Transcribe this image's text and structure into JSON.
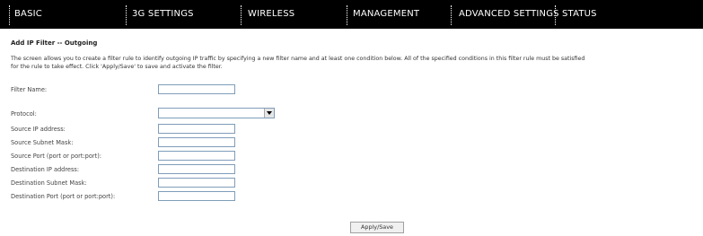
{
  "nav": {
    "items": [
      "BASIC",
      "3G SETTINGS",
      "WIRELESS",
      "MANAGEMENT",
      "ADVANCED SETTINGS",
      "STATUS"
    ]
  },
  "page": {
    "title": "Add IP Filter -- Outgoing",
    "description_line1": "The screen allows you to create a filter rule to identify outgoing IP traffic by specifying a new filter name and at least one condition below. All of the specified conditions in this filter rule must be satisfied",
    "description_line2": "for the rule to take effect. Click 'Apply/Save' to save and activate the filter."
  },
  "form": {
    "filter_name_label": "Filter Name:",
    "protocol_label": "Protocol:",
    "protocol_value": "",
    "source_ip_label": "Source IP address:",
    "source_mask_label": "Source Subnet Mask:",
    "source_port_label": "Source Port (port or port:port):",
    "dest_ip_label": "Destination IP address:",
    "dest_mask_label": "Destination Subnet Mask:",
    "dest_port_label": "Destination Port (port or port:port):"
  },
  "actions": {
    "apply_label": "Apply/Save"
  }
}
